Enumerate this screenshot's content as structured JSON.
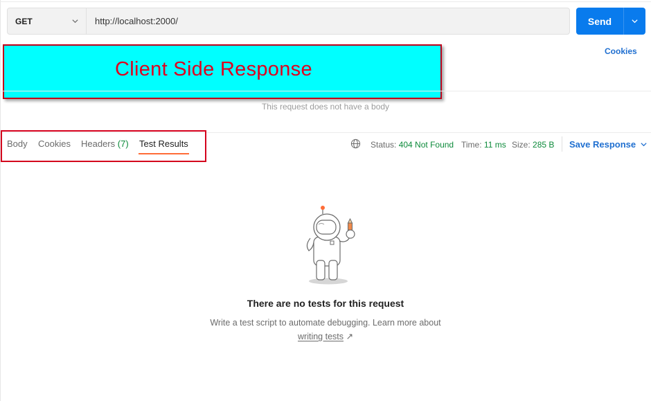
{
  "request": {
    "method": "GET",
    "url": "http://localhost:2000/",
    "send_label": "Send",
    "cookies_label": "Cookies",
    "no_body_text": "This request does not have a body"
  },
  "annotation": {
    "banner_text": "Client Side Response"
  },
  "response": {
    "tabs": [
      {
        "label": "Body"
      },
      {
        "label": "Cookies"
      },
      {
        "label": "Headers",
        "count": "(7)"
      },
      {
        "label": "Test Results",
        "active": true
      }
    ],
    "status_label": "Status:",
    "status_value": "404 Not Found",
    "time_label": "Time:",
    "time_value": "11 ms",
    "size_label": "Size:",
    "size_value": "285 B",
    "save_label": "Save Response"
  },
  "empty_state": {
    "title": "There are no tests for this request",
    "description": "Write a test script to automate debugging. Learn more about",
    "link_text": "writing tests",
    "link_icon": "↗"
  },
  "colors": {
    "send": "#097bed",
    "accent_orange": "#ff6c37",
    "status_green": "#0c8a3a",
    "link_blue": "#1f6fd0",
    "banner_bg": "#00ffff",
    "banner_border": "#c0001a",
    "banner_text": "#e0001e"
  }
}
